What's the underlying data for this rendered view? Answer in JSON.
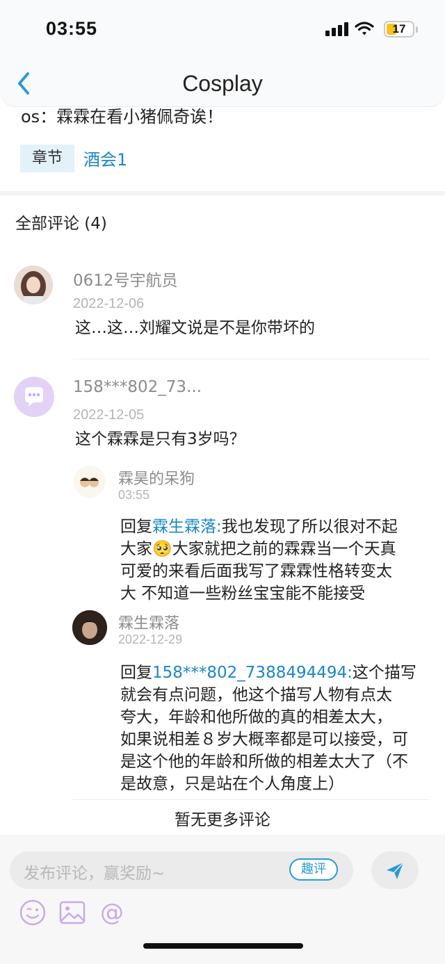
{
  "status_bar": {
    "time": "03:55",
    "battery": "17"
  },
  "nav": {
    "title": "Cosplay"
  },
  "post": {
    "os_text": "os：霖霖在看小猪佩奇诶！",
    "chapter_label": "章节",
    "chapter_name": "酒会1"
  },
  "comments_header": "全部评论 (4)",
  "comments": [
    {
      "user": "0612号宇航员",
      "date": "2022-12-06",
      "text": "这…这…刘耀文说是不是你带坏的"
    },
    {
      "user": "158***802_73...",
      "date": "2022-12-05",
      "text": "这个霖霖是只有3岁吗？"
    }
  ],
  "replies": [
    {
      "user": "霖昊的呆狗",
      "date": "03:55",
      "prefix": "回复",
      "target": "霖生霖落:",
      "lines": [
        "我也发现了所以很对不起",
        "大家🥺大家就把之前的霖霖当一个天真",
        "可爱的来看后面我写了霖霖性格转变太",
        "大 不知道一些粉丝宝宝能不能接受"
      ]
    },
    {
      "user": "霖生霖落",
      "date": "2022-12-29",
      "prefix": "回复",
      "target": "158***802_7388494494:",
      "lines": [
        "这个描写",
        "就会有点问题，他这个描写人物有点太",
        "夸大，年龄和他所做的真的相差太大，",
        "如果说相差８岁大概率都是可以接受，可",
        "是这个他的年龄和所做的相差太大了（不",
        "是故意，只是站在个人角度上）"
      ]
    }
  ],
  "footer_note": "暂无更多评论",
  "input": {
    "placeholder": "发布评论，赢奖励~",
    "quping_label": "趣评"
  },
  "colors": {
    "accent": "#1a86c8",
    "battery": "#f4c41b",
    "icon_purple": "#c9a8ef"
  },
  "icons": [
    "back-chevron-icon",
    "send-plane-icon",
    "emoji-icon",
    "image-icon",
    "at-icon"
  ]
}
